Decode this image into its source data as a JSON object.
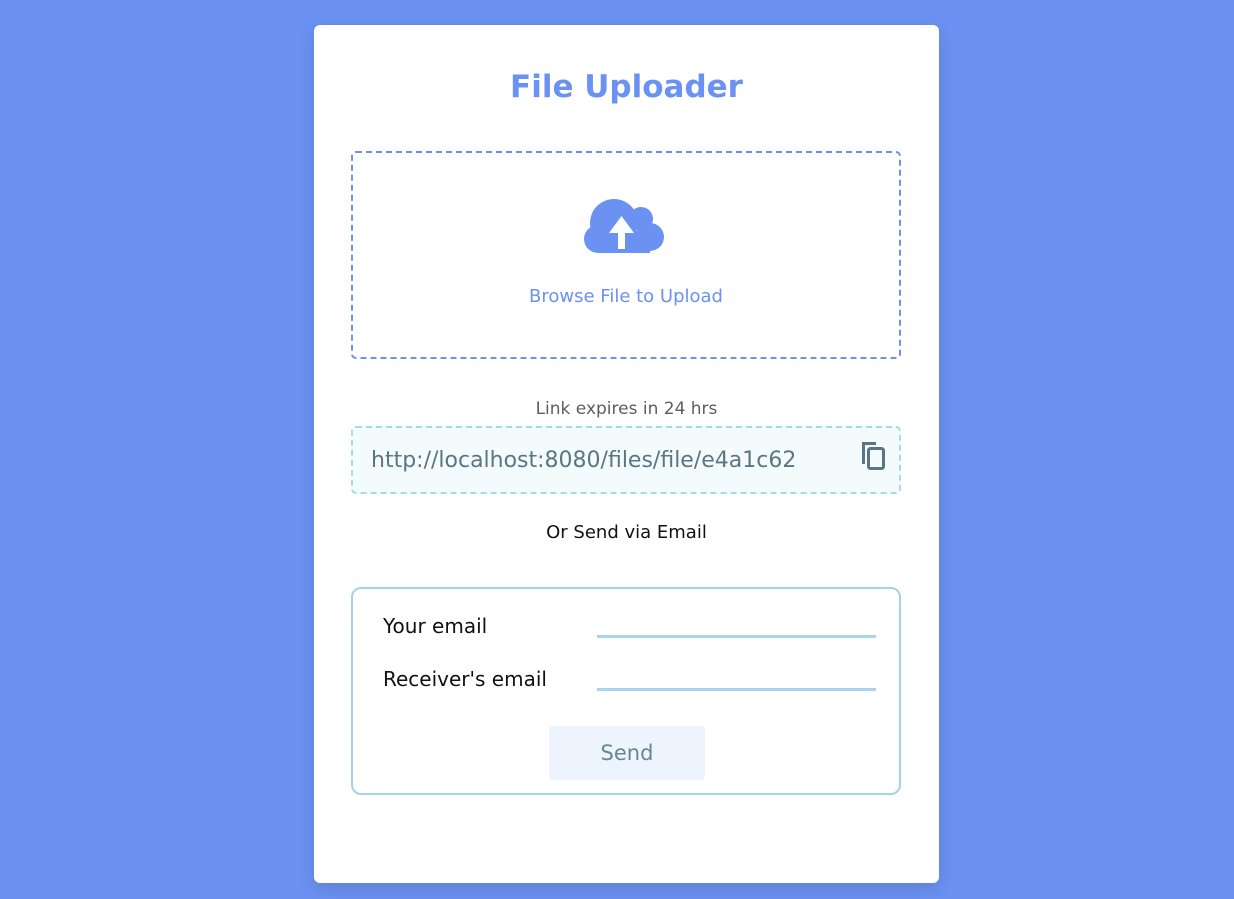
{
  "colors": {
    "background": "#6b91f2",
    "accent": "#6b91f2",
    "card": "#ffffff",
    "link_border": "#a6dbe6",
    "form_border": "#a6d2e6"
  },
  "header": {
    "title": "File Uploader"
  },
  "upload": {
    "icon": "cloud-upload-icon",
    "browse_label": "Browse File to Upload"
  },
  "link": {
    "expire_text": "Link expires in 24 hrs",
    "url": "http://localhost:8080/files/file/e4a1c62",
    "copy_icon": "copy-icon"
  },
  "email": {
    "or_text": "Or Send via Email",
    "your_email_label": "Your email",
    "receiver_email_label": "Receiver's email",
    "send_label": "Send"
  }
}
